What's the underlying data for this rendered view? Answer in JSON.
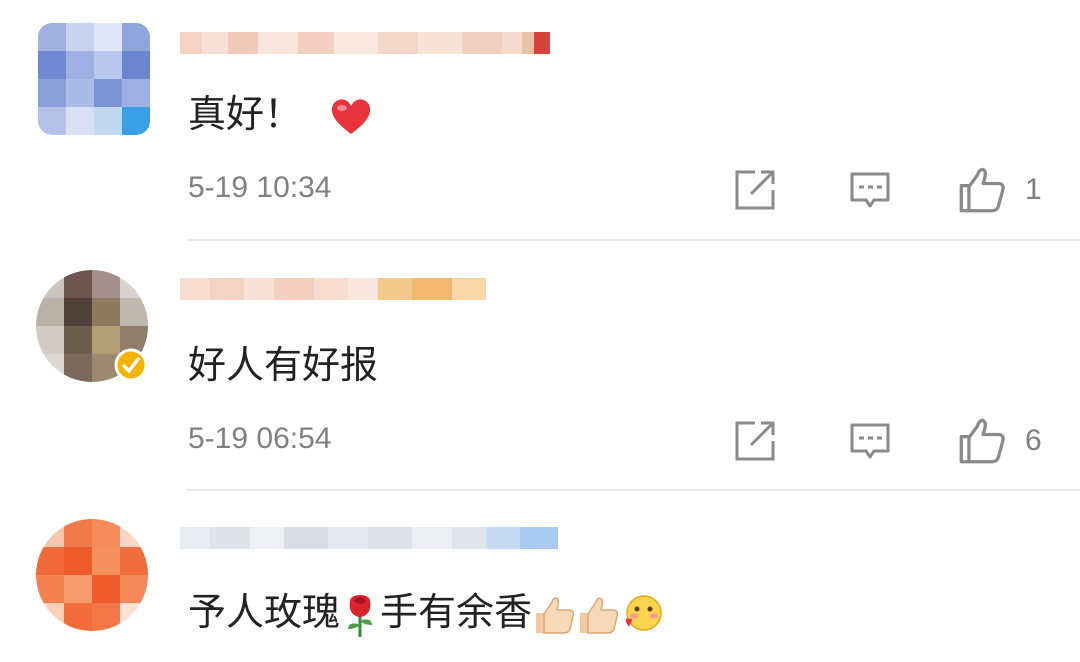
{
  "comments": [
    {
      "text": "真好！",
      "emoji_after": "heart-emoji",
      "time": "5-19 10:34",
      "likes": "1"
    },
    {
      "text": "好人有好报",
      "time": "5-19 06:54",
      "likes": "6",
      "verified_badge": true
    },
    {
      "text_parts": [
        "予人玫瑰",
        "手有余香"
      ],
      "emojis": [
        "rose-emoji",
        "thumbs-up-emoji",
        "thumbs-up-emoji",
        "blushing-kiss-emoji"
      ]
    }
  ],
  "actions": [
    "repost-icon",
    "reply-icon",
    "like-icon"
  ],
  "colors": {
    "text": "#222222",
    "meta": "#808080",
    "divider": "#e8e8e8",
    "heart": "#e8323c",
    "badge": "#f5b400"
  }
}
